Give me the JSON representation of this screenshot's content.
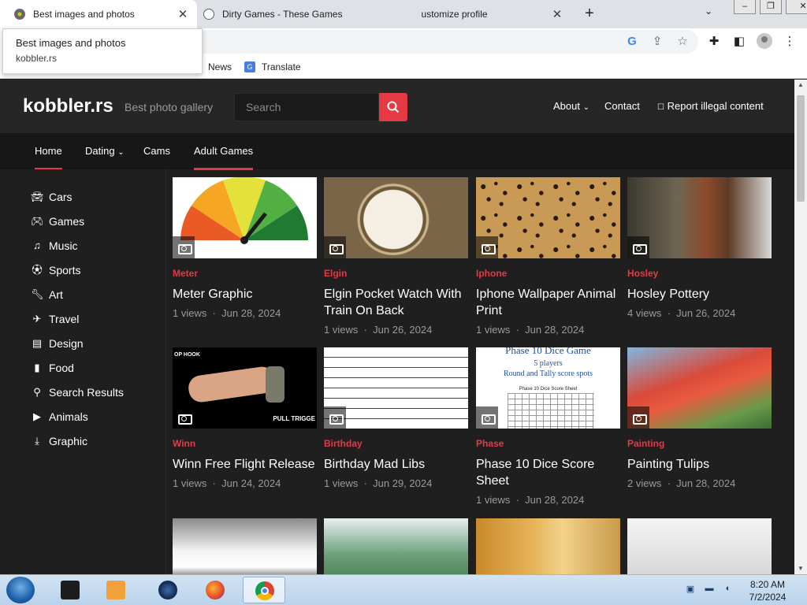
{
  "browser": {
    "tabs": [
      {
        "title": "Best images and photos",
        "active": true
      },
      {
        "title": "Dirty Games - These Games",
        "hidden_tail": "ustomize profile",
        "active": false
      }
    ],
    "hover_card": {
      "title": "Best images and photos",
      "url": "kobbler.rs"
    },
    "bookmarks": [
      {
        "label": "News"
      },
      {
        "label": "Translate"
      }
    ]
  },
  "site": {
    "logo": "kobbler.rs",
    "tagline": "Best photo gallery",
    "search_placeholder": "Search",
    "header_links": {
      "about": "About",
      "contact": "Contact",
      "report": "Report illegal content"
    },
    "main_nav": {
      "home": "Home",
      "dating": "Dating",
      "cams": "Cams",
      "games": "Adult Games"
    },
    "sidebar": [
      {
        "label": "Cars",
        "icon": "car-icon"
      },
      {
        "label": "Games",
        "icon": "gamepad-icon"
      },
      {
        "label": "Music",
        "icon": "music-note-icon"
      },
      {
        "label": "Sports",
        "icon": "soccer-ball-icon"
      },
      {
        "label": "Art",
        "icon": "wrench-icon"
      },
      {
        "label": "Travel",
        "icon": "airplane-icon"
      },
      {
        "label": "Design",
        "icon": "document-icon"
      },
      {
        "label": "Food",
        "icon": "file-icon"
      },
      {
        "label": "Search Results",
        "icon": "search-icon"
      },
      {
        "label": "Animals",
        "icon": "play-icon"
      },
      {
        "label": "Graphic",
        "icon": "download-icon"
      }
    ],
    "cards": [
      {
        "cat": "Meter",
        "title": "Meter Graphic",
        "views": "1 views",
        "date": "Jun 28, 2024"
      },
      {
        "cat": "Elgin",
        "title": "Elgin Pocket Watch With Train On Back",
        "views": "1 views",
        "date": "Jun 26, 2024"
      },
      {
        "cat": "Iphone",
        "title": "Iphone Wallpaper Animal Print",
        "views": "1 views",
        "date": "Jun 28, 2024"
      },
      {
        "cat": "Hosley",
        "title": "Hosley Pottery",
        "views": "4 views",
        "date": "Jun 26, 2024"
      },
      {
        "cat": "Winn",
        "title": "Winn Free Flight Release",
        "views": "1 views",
        "date": "Jun 24, 2024"
      },
      {
        "cat": "Birthday",
        "title": "Birthday Mad Libs",
        "views": "1 views",
        "date": "Jun 29, 2024"
      },
      {
        "cat": "Phase",
        "title": "Phase 10 Dice Score Sheet",
        "views": "1 views",
        "date": "Jun 28, 2024"
      },
      {
        "cat": "Painting",
        "title": "Painting Tulips",
        "views": "2 views",
        "date": "Jun 28, 2024"
      }
    ],
    "thumb_text": {
      "winn_caption_left": "OP HOOK",
      "winn_caption_right": "PULL TRIGGE",
      "phase_title": "Phase 10 Dice Game",
      "phase_players": "5 players",
      "phase_sub": "Round and Tally score spots",
      "phase_sheet": "Phase 10 Dice Score Sheet"
    }
  },
  "taskbar": {
    "time": "8:20 AM",
    "date": "7/2/2024"
  },
  "colors": {
    "accent": "#e53945",
    "header_bg": "#262626",
    "page_bg": "#1f1f1f"
  }
}
